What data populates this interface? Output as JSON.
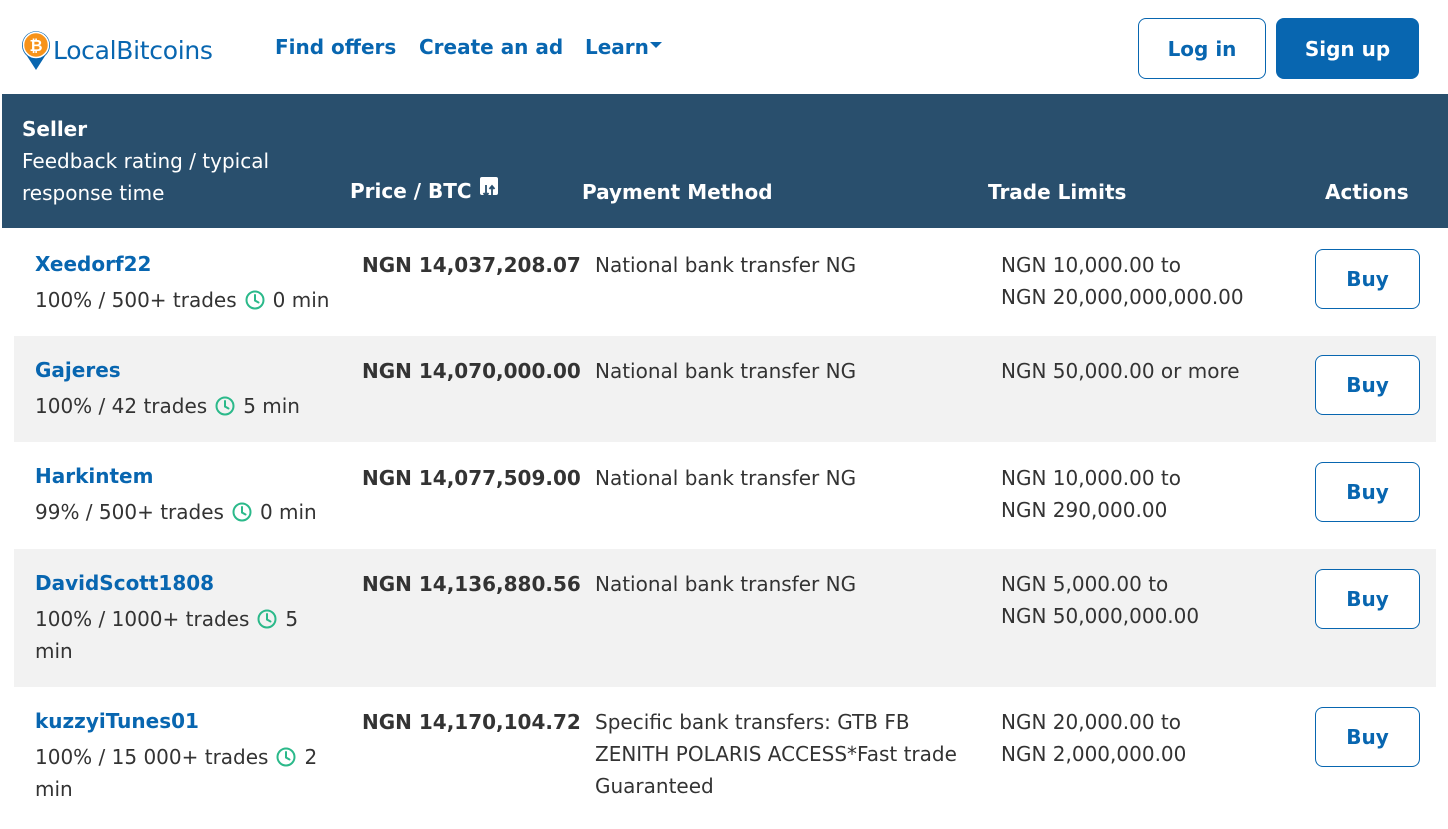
{
  "brand": {
    "name": "LocalBitcoins",
    "color": "#0866b0",
    "icon": "bitcoin-pin-logo"
  },
  "nav": {
    "find_offers": "Find offers",
    "create_ad": "Create an ad",
    "learn": "Learn",
    "login": "Log in",
    "signup": "Sign up"
  },
  "table": {
    "headers": {
      "seller": "Seller",
      "seller_sub": "Feedback rating / typical response time",
      "price": "Price / BTC",
      "payment": "Payment Method",
      "limits": "Trade Limits",
      "actions": "Actions"
    },
    "rows": [
      {
        "seller": "Xeedorf22",
        "rating": "100% / 500+ trades",
        "response": "0 min",
        "price": "NGN 14,037,208.07",
        "payment": "National bank transfer NG",
        "limit_line1": "NGN 10,000.00 to",
        "limit_line2": "NGN 20,000,000,000.00",
        "action": "Buy"
      },
      {
        "seller": "Gajeres",
        "rating": "100% / 42 trades",
        "response": "5 min",
        "price": "NGN 14,070,000.00",
        "payment": "National bank transfer NG",
        "limit_line1": "NGN 50,000.00 or more",
        "limit_line2": "",
        "action": "Buy"
      },
      {
        "seller": "Harkintem",
        "rating": "99% / 500+ trades",
        "response": "0 min",
        "price": "NGN 14,077,509.00",
        "payment": "National bank transfer NG",
        "limit_line1": "NGN 10,000.00 to",
        "limit_line2": "NGN 290,000.00",
        "action": "Buy"
      },
      {
        "seller": "DavidScott1808",
        "rating": "100% / 1000+ trades",
        "response": "5 min",
        "price": "NGN 14,136,880.56",
        "payment": "National bank transfer NG",
        "limit_line1": "NGN 5,000.00 to",
        "limit_line2": "NGN 50,000,000.00",
        "action": "Buy"
      },
      {
        "seller": "kuzzyiTunes01",
        "rating": "100% / 15 000+ trades",
        "response": "2 min",
        "price": "NGN 14,170,104.72",
        "payment": "Specific bank transfers: GTB FB ZENITH POLARIS ACCESS*Fast trade Guaranteed",
        "limit_line1": "NGN 20,000.00 to",
        "limit_line2": "NGN 2,000,000.00",
        "action": "Buy"
      }
    ]
  },
  "colors": {
    "header_bg": "#294f6d",
    "accent": "#0866b0",
    "clock": "#2bb98a",
    "row_alt": "#f2f2f2"
  }
}
